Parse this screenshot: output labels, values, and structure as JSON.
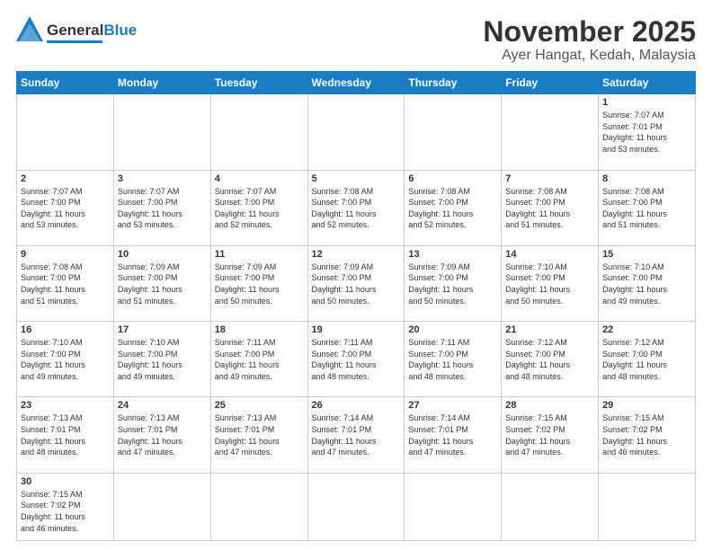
{
  "header": {
    "logo": {
      "part1": "General",
      "part2": "Blue"
    },
    "title": "November 2025",
    "subtitle": "Ayer Hangat, Kedah, Malaysia"
  },
  "days_of_week": [
    "Sunday",
    "Monday",
    "Tuesday",
    "Wednesday",
    "Thursday",
    "Friday",
    "Saturday"
  ],
  "weeks": [
    [
      {
        "day": "",
        "info": ""
      },
      {
        "day": "",
        "info": ""
      },
      {
        "day": "",
        "info": ""
      },
      {
        "day": "",
        "info": ""
      },
      {
        "day": "",
        "info": ""
      },
      {
        "day": "",
        "info": ""
      },
      {
        "day": "1",
        "info": "Sunrise: 7:07 AM\nSunset: 7:01 PM\nDaylight: 11 hours\nand 53 minutes."
      }
    ],
    [
      {
        "day": "2",
        "info": "Sunrise: 7:07 AM\nSunset: 7:00 PM\nDaylight: 11 hours\nand 53 minutes."
      },
      {
        "day": "3",
        "info": "Sunrise: 7:07 AM\nSunset: 7:00 PM\nDaylight: 11 hours\nand 53 minutes."
      },
      {
        "day": "4",
        "info": "Sunrise: 7:07 AM\nSunset: 7:00 PM\nDaylight: 11 hours\nand 52 minutes."
      },
      {
        "day": "5",
        "info": "Sunrise: 7:08 AM\nSunset: 7:00 PM\nDaylight: 11 hours\nand 52 minutes."
      },
      {
        "day": "6",
        "info": "Sunrise: 7:08 AM\nSunset: 7:00 PM\nDaylight: 11 hours\nand 52 minutes."
      },
      {
        "day": "7",
        "info": "Sunrise: 7:08 AM\nSunset: 7:00 PM\nDaylight: 11 hours\nand 51 minutes."
      },
      {
        "day": "8",
        "info": "Sunrise: 7:08 AM\nSunset: 7:00 PM\nDaylight: 11 hours\nand 51 minutes."
      }
    ],
    [
      {
        "day": "9",
        "info": "Sunrise: 7:08 AM\nSunset: 7:00 PM\nDaylight: 11 hours\nand 51 minutes."
      },
      {
        "day": "10",
        "info": "Sunrise: 7:09 AM\nSunset: 7:00 PM\nDaylight: 11 hours\nand 51 minutes."
      },
      {
        "day": "11",
        "info": "Sunrise: 7:09 AM\nSunset: 7:00 PM\nDaylight: 11 hours\nand 50 minutes."
      },
      {
        "day": "12",
        "info": "Sunrise: 7:09 AM\nSunset: 7:00 PM\nDaylight: 11 hours\nand 50 minutes."
      },
      {
        "day": "13",
        "info": "Sunrise: 7:09 AM\nSunset: 7:00 PM\nDaylight: 11 hours\nand 50 minutes."
      },
      {
        "day": "14",
        "info": "Sunrise: 7:10 AM\nSunset: 7:00 PM\nDaylight: 11 hours\nand 50 minutes."
      },
      {
        "day": "15",
        "info": "Sunrise: 7:10 AM\nSunset: 7:00 PM\nDaylight: 11 hours\nand 49 minutes."
      }
    ],
    [
      {
        "day": "16",
        "info": "Sunrise: 7:10 AM\nSunset: 7:00 PM\nDaylight: 11 hours\nand 49 minutes."
      },
      {
        "day": "17",
        "info": "Sunrise: 7:10 AM\nSunset: 7:00 PM\nDaylight: 11 hours\nand 49 minutes."
      },
      {
        "day": "18",
        "info": "Sunrise: 7:11 AM\nSunset: 7:00 PM\nDaylight: 11 hours\nand 49 minutes."
      },
      {
        "day": "19",
        "info": "Sunrise: 7:11 AM\nSunset: 7:00 PM\nDaylight: 11 hours\nand 48 minutes."
      },
      {
        "day": "20",
        "info": "Sunrise: 7:11 AM\nSunset: 7:00 PM\nDaylight: 11 hours\nand 48 minutes."
      },
      {
        "day": "21",
        "info": "Sunrise: 7:12 AM\nSunset: 7:00 PM\nDaylight: 11 hours\nand 48 minutes."
      },
      {
        "day": "22",
        "info": "Sunrise: 7:12 AM\nSunset: 7:00 PM\nDaylight: 11 hours\nand 48 minutes."
      }
    ],
    [
      {
        "day": "23",
        "info": "Sunrise: 7:13 AM\nSunset: 7:01 PM\nDaylight: 11 hours\nand 48 minutes."
      },
      {
        "day": "24",
        "info": "Sunrise: 7:13 AM\nSunset: 7:01 PM\nDaylight: 11 hours\nand 47 minutes."
      },
      {
        "day": "25",
        "info": "Sunrise: 7:13 AM\nSunset: 7:01 PM\nDaylight: 11 hours\nand 47 minutes."
      },
      {
        "day": "26",
        "info": "Sunrise: 7:14 AM\nSunset: 7:01 PM\nDaylight: 11 hours\nand 47 minutes."
      },
      {
        "day": "27",
        "info": "Sunrise: 7:14 AM\nSunset: 7:01 PM\nDaylight: 11 hours\nand 47 minutes."
      },
      {
        "day": "28",
        "info": "Sunrise: 7:15 AM\nSunset: 7:02 PM\nDaylight: 11 hours\nand 47 minutes."
      },
      {
        "day": "29",
        "info": "Sunrise: 7:15 AM\nSunset: 7:02 PM\nDaylight: 11 hours\nand 46 minutes."
      }
    ],
    [
      {
        "day": "30",
        "info": "Sunrise: 7:15 AM\nSunset: 7:02 PM\nDaylight: 11 hours\nand 46 minutes."
      },
      {
        "day": "",
        "info": ""
      },
      {
        "day": "",
        "info": ""
      },
      {
        "day": "",
        "info": ""
      },
      {
        "day": "",
        "info": ""
      },
      {
        "day": "",
        "info": ""
      },
      {
        "day": "",
        "info": ""
      }
    ]
  ]
}
